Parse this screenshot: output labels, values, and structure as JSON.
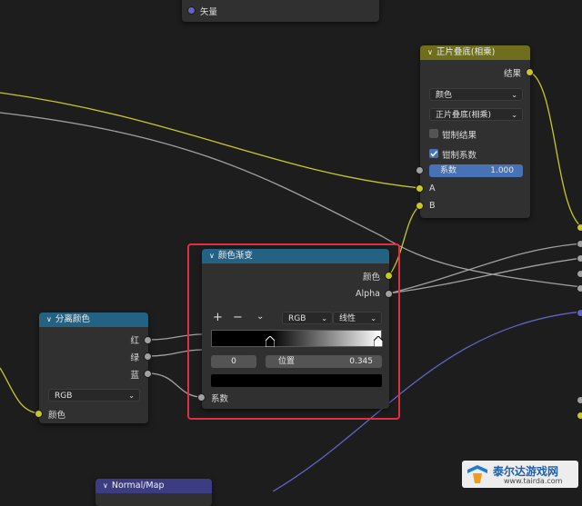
{
  "vector_node": {
    "output_label": "矢量"
  },
  "multiply_node": {
    "title": "正片叠底(相乘)",
    "output_label": "结果",
    "data_type": "颜色",
    "blend_mode": "正片叠底(相乘)",
    "clamp_result_label": "钳制结果",
    "clamp_result_checked": false,
    "clamp_factor_label": "钳制系数",
    "clamp_factor_checked": true,
    "factor_label": "系数",
    "factor_value": "1.000",
    "input_a": "A",
    "input_b": "B"
  },
  "color_ramp_node": {
    "title": "颜色渐变",
    "output_color": "颜色",
    "output_alpha": "Alpha",
    "add_label": "+",
    "remove_label": "−",
    "color_mode": "RGB",
    "interpolation": "线性",
    "stop_index": "0",
    "position_label": "位置",
    "position_value": "0.345",
    "input_factor": "系数"
  },
  "separate_color_node": {
    "title": "分离颜色",
    "output_red": "红",
    "output_green": "绿",
    "output_blue": "蓝",
    "mode": "RGB",
    "input_color": "颜色"
  },
  "normal_map_node": {
    "title": "Normal/Map"
  },
  "watermark": {
    "name": "泰尔达游戏网",
    "url": "www.tairda.com"
  },
  "colors": {
    "converter_header": "#246283",
    "color_header": "#6e6e1d",
    "vector_header": "#3c3c83",
    "highlight": "#e0303f",
    "socket_color": "#c7c729",
    "socket_float": "#a1a1a1",
    "socket_vector": "#6363c7"
  }
}
